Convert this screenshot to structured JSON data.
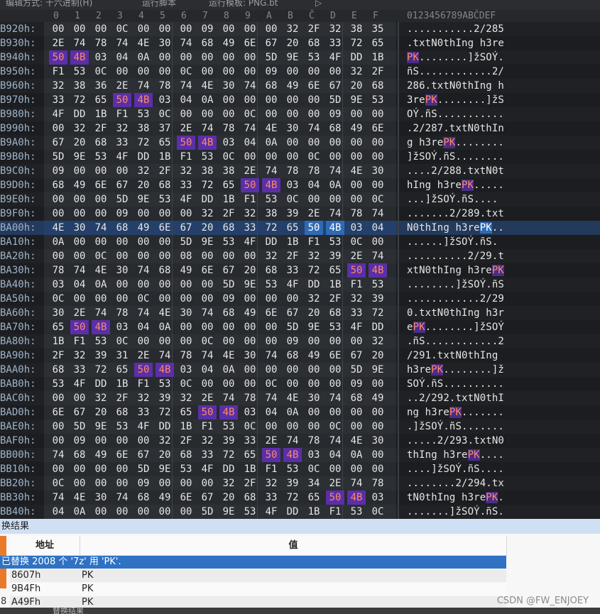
{
  "toolbar": {
    "edit_mode": "编辑方式: 十六进制(H)",
    "run_script": "运行脚本",
    "run_template": "运行模板: PNG.bt",
    "arrow": "▷"
  },
  "columns": {
    "hex_headers": [
      "0",
      "1",
      "2",
      "3",
      "4",
      "5",
      "6",
      "7",
      "8",
      "9",
      "A",
      "B",
      "Č",
      "D",
      "E",
      "F"
    ],
    "ascii_header": "0123456789ABČDEF"
  },
  "rows": [
    {
      "addr": "B920h:",
      "bytes": [
        "00",
        "00",
        "00",
        "0C",
        "00",
        "00",
        "00",
        "09",
        "00",
        "00",
        "00",
        "32",
        "2F",
        "32",
        "38",
        "35"
      ],
      "ascii": "...........2/285"
    },
    {
      "addr": "B930h:",
      "bytes": [
        "2E",
        "74",
        "78",
        "74",
        "4E",
        "30",
        "74",
        "68",
        "49",
        "6E",
        "67",
        "20",
        "68",
        "33",
        "72",
        "65"
      ],
      "ascii": ".txtN0thIng h3re"
    },
    {
      "addr": "B940h:",
      "bytes": [
        "50",
        "4B",
        "03",
        "04",
        "0A",
        "00",
        "00",
        "00",
        "00",
        "00",
        "5D",
        "9E",
        "53",
        "4F",
        "DD",
        "1B"
      ],
      "ascii": "PK........]žSOÝ."
    },
    {
      "addr": "B950h:",
      "bytes": [
        "F1",
        "53",
        "0C",
        "00",
        "00",
        "00",
        "0C",
        "00",
        "00",
        "00",
        "09",
        "00",
        "00",
        "00",
        "32",
        "2F"
      ],
      "ascii": "ñS............2/"
    },
    {
      "addr": "B960h:",
      "bytes": [
        "32",
        "38",
        "36",
        "2E",
        "74",
        "78",
        "74",
        "4E",
        "30",
        "74",
        "68",
        "49",
        "6E",
        "67",
        "20",
        "68"
      ],
      "ascii": "286.txtN0thIng h"
    },
    {
      "addr": "B970h:",
      "bytes": [
        "33",
        "72",
        "65",
        "50",
        "4B",
        "03",
        "04",
        "0A",
        "00",
        "00",
        "00",
        "00",
        "00",
        "5D",
        "9E",
        "53"
      ],
      "ascii": "3rePK........]žS"
    },
    {
      "addr": "B980h:",
      "bytes": [
        "4F",
        "DD",
        "1B",
        "F1",
        "53",
        "0C",
        "00",
        "00",
        "00",
        "0C",
        "00",
        "00",
        "00",
        "09",
        "00",
        "00"
      ],
      "ascii": "OÝ.ñS..........."
    },
    {
      "addr": "B990h:",
      "bytes": [
        "00",
        "32",
        "2F",
        "32",
        "38",
        "37",
        "2E",
        "74",
        "78",
        "74",
        "4E",
        "30",
        "74",
        "68",
        "49",
        "6E"
      ],
      "ascii": ".2/287.txtN0thIn"
    },
    {
      "addr": "B9A0h:",
      "bytes": [
        "67",
        "20",
        "68",
        "33",
        "72",
        "65",
        "50",
        "4B",
        "03",
        "04",
        "0A",
        "00",
        "00",
        "00",
        "00",
        "00"
      ],
      "ascii": "g h3rePK........"
    },
    {
      "addr": "B9B0h:",
      "bytes": [
        "5D",
        "9E",
        "53",
        "4F",
        "DD",
        "1B",
        "F1",
        "53",
        "0C",
        "00",
        "00",
        "00",
        "0C",
        "00",
        "00",
        "00"
      ],
      "ascii": "]žSOÝ.ñS........"
    },
    {
      "addr": "B9C0h:",
      "bytes": [
        "09",
        "00",
        "00",
        "00",
        "32",
        "2F",
        "32",
        "38",
        "38",
        "2E",
        "74",
        "78",
        "78",
        "74",
        "4E",
        "30",
        "74"
      ],
      "ascii": "....2/288.txtN0t"
    },
    {
      "addr": "B9D0h:",
      "bytes": [
        "68",
        "49",
        "6E",
        "67",
        "20",
        "68",
        "33",
        "72",
        "65",
        "50",
        "4B",
        "03",
        "04",
        "0A",
        "00",
        "00"
      ],
      "ascii": "hIng h3rePK....."
    },
    {
      "addr": "B9E0h:",
      "bytes": [
        "00",
        "00",
        "00",
        "5D",
        "9E",
        "53",
        "4F",
        "DD",
        "1B",
        "F1",
        "53",
        "0C",
        "00",
        "00",
        "00",
        "0C"
      ],
      "ascii": "...]žSOÝ.ñS...."
    },
    {
      "addr": "B9F0h:",
      "bytes": [
        "00",
        "00",
        "00",
        "09",
        "00",
        "00",
        "00",
        "32",
        "2F",
        "32",
        "38",
        "39",
        "2E",
        "74",
        "78",
        "74"
      ],
      "ascii": ".......2/289.txt"
    },
    {
      "addr": "BA00h:",
      "bytes": [
        "4E",
        "30",
        "74",
        "68",
        "49",
        "6E",
        "67",
        "20",
        "68",
        "33",
        "72",
        "65",
        "50",
        "4B",
        "03",
        "04"
      ],
      "ascii": "N0thIng h3rePK.."
    },
    {
      "addr": "BA10h:",
      "bytes": [
        "0A",
        "00",
        "00",
        "00",
        "00",
        "00",
        "5D",
        "9E",
        "53",
        "4F",
        "DD",
        "1B",
        "F1",
        "53",
        "0C",
        "00"
      ],
      "ascii": "......]žSOÝ.ñS."
    },
    {
      "addr": "BA20h:",
      "bytes": [
        "00",
        "00",
        "0C",
        "00",
        "00",
        "00",
        "08",
        "00",
        "00",
        "00",
        "32",
        "2F",
        "32",
        "39",
        "2E",
        "74"
      ],
      "ascii": "..........2/29.t"
    },
    {
      "addr": "BA30h:",
      "bytes": [
        "78",
        "74",
        "4E",
        "30",
        "74",
        "68",
        "49",
        "6E",
        "67",
        "20",
        "68",
        "33",
        "72",
        "65",
        "50",
        "4B"
      ],
      "ascii": "xtN0thIng h3rePK"
    },
    {
      "addr": "BA40h:",
      "bytes": [
        "03",
        "04",
        "0A",
        "00",
        "00",
        "00",
        "00",
        "00",
        "5D",
        "9E",
        "53",
        "4F",
        "DD",
        "1B",
        "F1",
        "53"
      ],
      "ascii": "........]žSOÝ.ñS"
    },
    {
      "addr": "BA50h:",
      "bytes": [
        "0C",
        "00",
        "00",
        "00",
        "0C",
        "00",
        "00",
        "00",
        "09",
        "00",
        "00",
        "00",
        "32",
        "2F",
        "32",
        "39"
      ],
      "ascii": "............2/29"
    },
    {
      "addr": "BA60h:",
      "bytes": [
        "30",
        "2E",
        "74",
        "78",
        "74",
        "4E",
        "30",
        "74",
        "68",
        "49",
        "6E",
        "67",
        "20",
        "68",
        "33",
        "72"
      ],
      "ascii": "0.txtN0thIng h3r"
    },
    {
      "addr": "BA70h:",
      "bytes": [
        "65",
        "50",
        "4B",
        "03",
        "04",
        "0A",
        "00",
        "00",
        "00",
        "00",
        "00",
        "5D",
        "9E",
        "53",
        "4F",
        "DD"
      ],
      "ascii": "ePK........]žSOÝ"
    },
    {
      "addr": "BA80h:",
      "bytes": [
        "1B",
        "F1",
        "53",
        "0C",
        "00",
        "00",
        "00",
        "0C",
        "00",
        "00",
        "00",
        "09",
        "00",
        "00",
        "00",
        "32"
      ],
      "ascii": ".ñS............2"
    },
    {
      "addr": "BA90h:",
      "bytes": [
        "2F",
        "32",
        "39",
        "31",
        "2E",
        "74",
        "78",
        "74",
        "4E",
        "30",
        "74",
        "68",
        "49",
        "6E",
        "67",
        "20"
      ],
      "ascii": "/291.txtN0thIng "
    },
    {
      "addr": "BAA0h:",
      "bytes": [
        "68",
        "33",
        "72",
        "65",
        "50",
        "4B",
        "03",
        "04",
        "0A",
        "00",
        "00",
        "00",
        "00",
        "00",
        "5D",
        "9E"
      ],
      "ascii": "h3rePK........]ž"
    },
    {
      "addr": "BAB0h:",
      "bytes": [
        "53",
        "4F",
        "DD",
        "1B",
        "F1",
        "53",
        "0C",
        "00",
        "00",
        "00",
        "0C",
        "00",
        "00",
        "00",
        "09",
        "00"
      ],
      "ascii": "SOÝ.ñS.........."
    },
    {
      "addr": "BAC0h:",
      "bytes": [
        "00",
        "00",
        "32",
        "2F",
        "32",
        "39",
        "32",
        "2E",
        "74",
        "78",
        "74",
        "4E",
        "30",
        "74",
        "68",
        "49"
      ],
      "ascii": "..2/292.txtN0thI"
    },
    {
      "addr": "BAD0h:",
      "bytes": [
        "6E",
        "67",
        "20",
        "68",
        "33",
        "72",
        "65",
        "50",
        "4B",
        "03",
        "04",
        "0A",
        "00",
        "00",
        "00",
        "00"
      ],
      "ascii": "ng h3rePK......."
    },
    {
      "addr": "BAE0h:",
      "bytes": [
        "00",
        "5D",
        "9E",
        "53",
        "4F",
        "DD",
        "1B",
        "F1",
        "53",
        "0C",
        "00",
        "00",
        "00",
        "0C",
        "00",
        "00"
      ],
      "ascii": ".]žSOÝ.ñS......."
    },
    {
      "addr": "BAF0h:",
      "bytes": [
        "00",
        "09",
        "00",
        "00",
        "00",
        "32",
        "2F",
        "32",
        "39",
        "33",
        "2E",
        "74",
        "78",
        "74",
        "4E",
        "30"
      ],
      "ascii": ".....2/293.txtN0"
    },
    {
      "addr": "BB00h:",
      "bytes": [
        "74",
        "68",
        "49",
        "6E",
        "67",
        "20",
        "68",
        "33",
        "72",
        "65",
        "50",
        "4B",
        "03",
        "04",
        "0A",
        "00"
      ],
      "ascii": "thIng h3rePK...."
    },
    {
      "addr": "BB10h:",
      "bytes": [
        "00",
        "00",
        "00",
        "00",
        "5D",
        "9E",
        "53",
        "4F",
        "DD",
        "1B",
        "F1",
        "53",
        "0C",
        "00",
        "00",
        "00"
      ],
      "ascii": "....]žSOÝ.ñS...."
    },
    {
      "addr": "BB20h:",
      "bytes": [
        "0C",
        "00",
        "00",
        "00",
        "09",
        "00",
        "00",
        "00",
        "32",
        "2F",
        "32",
        "39",
        "34",
        "2E",
        "74",
        "78"
      ],
      "ascii": "........2/294.tx"
    },
    {
      "addr": "BB30h:",
      "bytes": [
        "74",
        "4E",
        "30",
        "74",
        "68",
        "49",
        "6E",
        "67",
        "20",
        "68",
        "33",
        "72",
        "65",
        "50",
        "4B",
        "03"
      ],
      "ascii": "tN0thIng h3rePK."
    },
    {
      "addr": "BB40h:",
      "bytes": [
        "04",
        "0A",
        "00",
        "00",
        "00",
        "00",
        "00",
        "5D",
        "9E",
        "53",
        "4F",
        "DD",
        "1B",
        "F1",
        "53",
        "0C"
      ],
      "ascii": ".......]žSOÝ.ñS."
    }
  ],
  "selected_row": 14,
  "highlight_color": "#5a2fa8",
  "cursor_color": "#2f6bb4",
  "results": {
    "title": "换结果",
    "col_address": "地址",
    "col_value": "值",
    "summary": "已替换 2008 个 '7z' 用 'PK'.",
    "items": [
      {
        "address": "8607h",
        "value": "PK"
      },
      {
        "address": "9B4Fh",
        "value": "PK"
      },
      {
        "address": "A49Fh",
        "value": "PK"
      }
    ],
    "side_number": "8"
  },
  "status": {
    "tab_label": "替换结果"
  },
  "watermark": "CSDN @FW_ENJOEY"
}
